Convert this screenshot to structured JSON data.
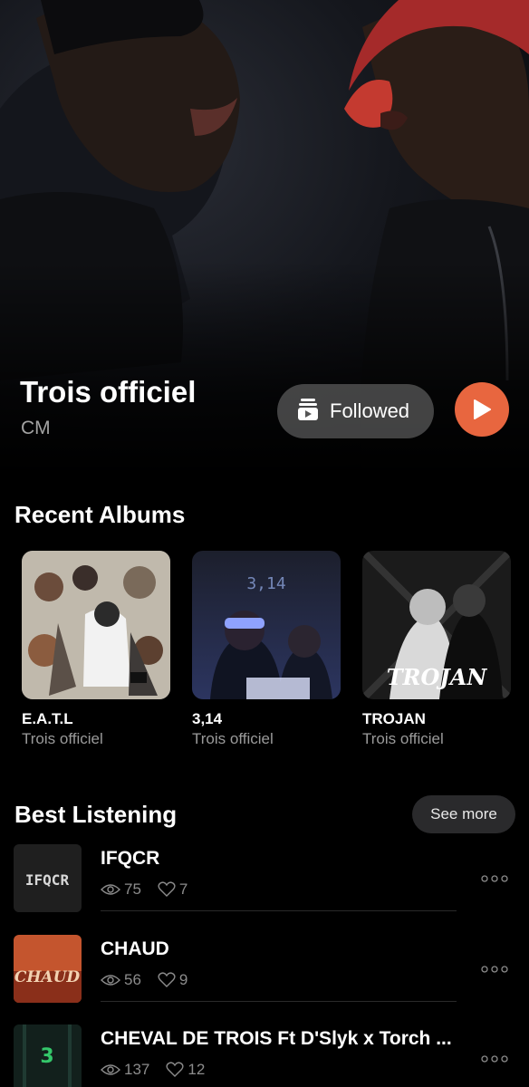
{
  "artist": {
    "name": "Trois officiel",
    "country": "CM",
    "follow_label": "Followed",
    "accent_color": "#e8663f"
  },
  "recent_albums": {
    "title": "Recent Albums",
    "items": [
      {
        "title": "E.A.T.L",
        "artist": "Trois officiel"
      },
      {
        "title": "3,14",
        "artist": "Trois officiel"
      },
      {
        "title": "TROJAN",
        "artist": "Trois officiel"
      }
    ]
  },
  "best_listening": {
    "title": "Best Listening",
    "see_more": "See more",
    "tracks": [
      {
        "title": "IFQCR",
        "views": "75",
        "likes": "7",
        "cover_text": "IFQCR"
      },
      {
        "title": "CHAUD",
        "views": "56",
        "likes": "9",
        "cover_text": "CHAUD"
      },
      {
        "title": "CHEVAL DE TROIS Ft D'Slyk x Torch ...",
        "views": "137",
        "likes": "12",
        "cover_text": "3"
      }
    ]
  },
  "album_cover_texts": {
    "a2": "3,14",
    "a3": "TROJAN"
  },
  "icons": {
    "follow": "follow-bookmark-icon",
    "play": "play-icon",
    "views": "eye-icon",
    "likes": "heart-icon",
    "more": "more-dots-icon"
  }
}
